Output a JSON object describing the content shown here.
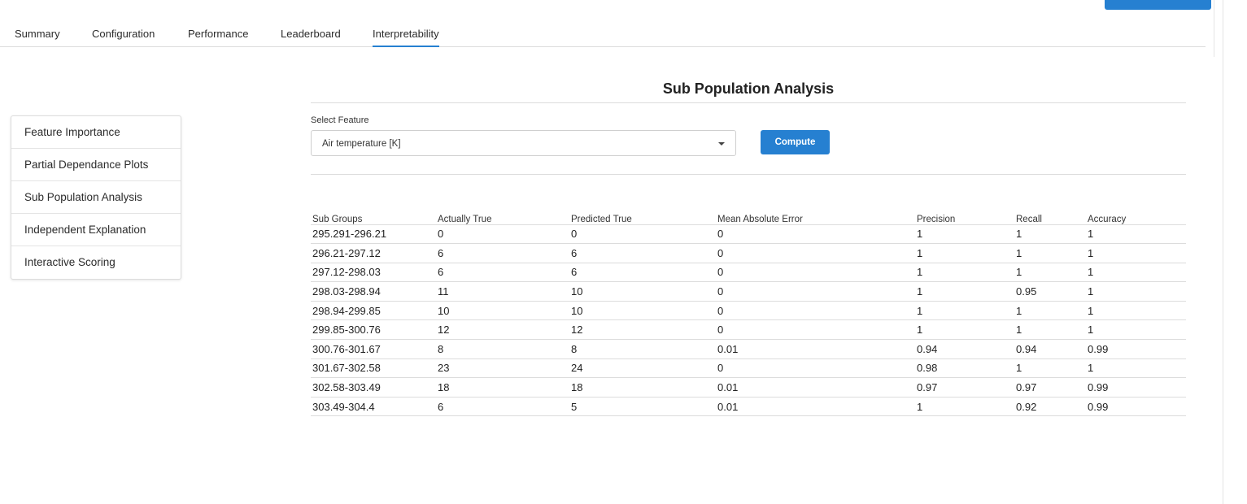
{
  "tabs": [
    "Summary",
    "Configuration",
    "Performance",
    "Leaderboard",
    "Interpretability"
  ],
  "active_tab": "Interpretability",
  "sidebar": {
    "items": [
      "Feature Importance",
      "Partial Dependance Plots",
      "Sub Population Analysis",
      "Independent Explanation",
      "Interactive Scoring"
    ]
  },
  "main": {
    "title": "Sub Population Analysis",
    "select_label": "Select Feature",
    "select_value": "Air temperature [K]",
    "compute_label": "Compute"
  },
  "table": {
    "headers": [
      "Sub Groups",
      "Actually True",
      "Predicted True",
      "Mean Absolute Error",
      "Precision",
      "Recall",
      "Accuracy"
    ],
    "rows": [
      [
        "295.291-296.21",
        "0",
        "0",
        "0",
        "1",
        "1",
        "1"
      ],
      [
        "296.21-297.12",
        "6",
        "6",
        "0",
        "1",
        "1",
        "1"
      ],
      [
        "297.12-298.03",
        "6",
        "6",
        "0",
        "1",
        "1",
        "1"
      ],
      [
        "298.03-298.94",
        "11",
        "10",
        "0",
        "1",
        "0.95",
        "1"
      ],
      [
        "298.94-299.85",
        "10",
        "10",
        "0",
        "1",
        "1",
        "1"
      ],
      [
        "299.85-300.76",
        "12",
        "12",
        "0",
        "1",
        "1",
        "1"
      ],
      [
        "300.76-301.67",
        "8",
        "8",
        "0.01",
        "0.94",
        "0.94",
        "0.99"
      ],
      [
        "301.67-302.58",
        "23",
        "24",
        "0",
        "0.98",
        "1",
        "1"
      ],
      [
        "302.58-303.49",
        "18",
        "18",
        "0.01",
        "0.97",
        "0.97",
        "0.99"
      ],
      [
        "303.49-304.4",
        "6",
        "5",
        "0.01",
        "1",
        "0.92",
        "0.99"
      ]
    ]
  },
  "colors": {
    "accent": "#2680d1",
    "border": "#dcdcdc"
  }
}
